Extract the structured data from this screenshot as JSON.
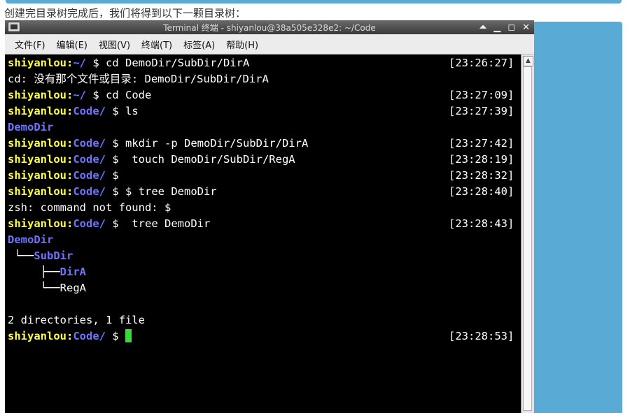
{
  "caption": "创建完目录树完成后，我们将得到以下一颗目录树：",
  "window": {
    "title": "Terminal 终端 - shiyanlou@38a505e328e2: ~/Code",
    "buttons": {
      "shade": "⏶",
      "minimize": "▁",
      "maximize": "◻",
      "close": "✕"
    }
  },
  "menu": [
    "文件(F)",
    "编辑(E)",
    "视图(V)",
    "终端(T)",
    "标签(A)",
    "帮助(H)"
  ],
  "terminal": {
    "user": "shiyanlou:",
    "lines": [
      {
        "path": "~/",
        "cmd": " $ cd DemoDir/SubDir/DirA",
        "time": "[23:26:27]"
      },
      {
        "text": "cd: 没有那个文件或目录: DemoDir/SubDir/DirA"
      },
      {
        "path": "~/",
        "cmd": " $ cd Code",
        "time": "[23:27:09]"
      },
      {
        "path": "Code/",
        "cmd": " $ ls",
        "time": "[23:27:39]"
      },
      {
        "dir": "DemoDir"
      },
      {
        "path": "Code/",
        "cmd": " $ mkdir -p DemoDir/SubDir/DirA",
        "time": "[23:27:42]"
      },
      {
        "path": "Code/",
        "cmd": " $  touch DemoDir/SubDir/RegA",
        "time": "[23:28:19]"
      },
      {
        "path": "Code/",
        "cmd": " $",
        "time": "[23:28:32]"
      },
      {
        "path": "Code/",
        "cmd": " $ $ tree DemoDir",
        "time": "[23:28:40]"
      },
      {
        "text": "zsh: command not found: $"
      },
      {
        "path": "Code/",
        "cmd": " $  tree DemoDir",
        "time": "[23:28:43]"
      },
      {
        "dir": "DemoDir"
      },
      {
        "prefix": " └──",
        "dir": "SubDir"
      },
      {
        "prefix": "     ├──",
        "dir": "DirA"
      },
      {
        "prefix": "     └──",
        "text": "RegA"
      },
      {
        "text": ""
      },
      {
        "text": "2 directories, 1 file"
      },
      {
        "path": "Code/",
        "cmd": " $ ",
        "time": "[23:28:53]",
        "cursor": true
      }
    ]
  }
}
